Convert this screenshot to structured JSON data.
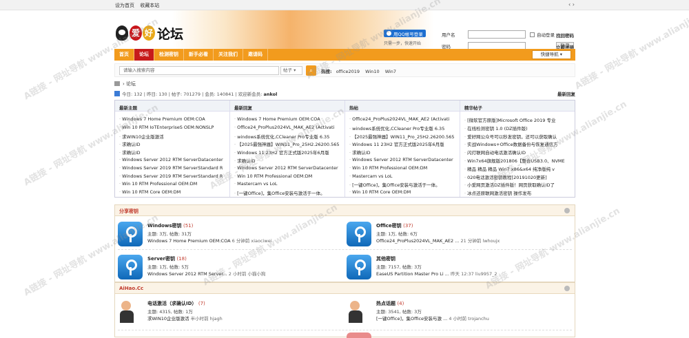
{
  "topbar": {
    "set_home": "设为首页",
    "bookmark": "收藏本站",
    "arrows": "‹ ›"
  },
  "logo": {
    "char1": "爱",
    "char2": "好",
    "title": "论坛"
  },
  "qq_login": {
    "button": "用QQ帐号登录",
    "hint": "只需一步，快速开始"
  },
  "login": {
    "username_label": "用户名",
    "password_label": "密码",
    "remember": "自动登录",
    "forgot": "找回密码",
    "submit": "登录",
    "register": "立即注册"
  },
  "nav": {
    "items": [
      "首页",
      "论坛",
      "检测密钥",
      "新手必看",
      "关注我们",
      "邀请码"
    ],
    "active_index": 1,
    "quick": "快捷导航 ▾"
  },
  "search": {
    "placeholder": "请输入搜索内容",
    "type": "帖子 ▾",
    "hot_label": "热搜:",
    "hot": [
      "office2019",
      "Win10",
      "Win7"
    ]
  },
  "breadcrumb": {
    "current": "论坛"
  },
  "stats": {
    "text": "今日: 132  |  昨日: 130  |  帖子: 701279  |  会员: 140841  |  欢迎新会员: ",
    "newest": "ankol",
    "latest": "最新回复"
  },
  "panels": [
    {
      "title": "最新主题",
      "items": [
        "Windows 7 Home Premium OEM:COA",
        "Win 10 RTM IoTEnterpriseS OEM:NONSLP",
        "求WIN10企业版激活",
        "求确认ID",
        "求确认ID",
        "Windows Server 2012 RTM ServerDatacenter",
        "Windows Server 2019 RTM ServerStandard R",
        "Windows Server 2019 RTM ServerStandard R",
        "Win 10 RTM Professional OEM:DM",
        "Win 10 RTM Core OEM:DM"
      ]
    },
    {
      "title": "最新回复",
      "items": [
        "Windows 7 Home Premium OEM:COA",
        "Office24_ProPlus2024VL_MAK_AE2 (Activati",
        "windows系统优化,CCleaner Pro专业版 6.35",
        "【2025最强神器】WIN11_Pro_25H2.26200.565",
        "Windows 11 23H2 官方正式版2025年6月版",
        "求确认ID",
        "Windows Server 2012 RTM ServerDatacenter",
        "Win 10 RTM Professional OEM:DM",
        "Mastercam vs LoL",
        "[一键Office]，集Office安装与激活于一体。"
      ]
    },
    {
      "title": "热帖",
      "items": [
        "Office24_ProPlus2024VL_MAK_AE2 (Activati",
        "windows系统优化,CCleaner Pro专业版 6.35",
        "【2025最强神器】WIN11_Pro_25H2.26200.565",
        "Windows 11 23H2 官方正式版2025年6月版",
        "求确认ID",
        "Windows Server 2012 RTM ServerDatacenter",
        "Win 10 RTM Professional OEM:DM",
        "Mastercam vs LoL",
        "[一键Office]，集Office安装与激活于一体。",
        "Win 10 RTM Core OEM:DM"
      ]
    },
    {
      "title": "精华帖子",
      "items": [
        "[微软官方原版]Microsoft Office 2019 专业",
        "在线检测密钥 1.0 (DZ插件版)",
        "爱好网公众号可以秒发密钥，还可以获取确认",
        "实战Windows+Office数据备份与恢复通信方",
        "闪灯联网自动电话激活确认ID",
        "Win7x64旗舰版201806【整合USB3.0、NVME",
        "精品 精品 精品 Win7 x86&x64 纯净版纯 v",
        "020电话激活密钥教程[20191020更新]",
        "小爱网页激活DZ插件版！网页获取确认ID了",
        "冰点还原联网激活密钥 操作发布"
      ]
    }
  ],
  "section1": {
    "title": "分享密钥",
    "forums": [
      {
        "name": "Windows密钥",
        "count": "(51)",
        "meta": "主题: 3万, 帖数: 31万",
        "last": "Windows 7 Home Premium OEM:COA",
        "time": "6 分钟前 xiaociwei"
      },
      {
        "name": "Office密钥",
        "count": "(37)",
        "meta": "主题: 1万, 帖数: 6万",
        "last": "Office24_ProPlus2024VL_MAK_AE2 ...",
        "time": "21 分钟前 lwhoujx"
      },
      {
        "name": "Server密钥",
        "count": "(18)",
        "meta": "主题: 1万, 帖数: 5万",
        "last": "Windows Server 2012 RTM Server...",
        "time": "2 小时前 小猫小狗"
      },
      {
        "name": "其他密钥",
        "count": "",
        "meta": "主题: 7157, 帖数: 3万",
        "last": "EaseUS Partition Master Pro Li ...",
        "time": "昨天 12:37 liu9957_2"
      }
    ]
  },
  "section2": {
    "title": "AiHao.Cc",
    "forums": [
      {
        "name": "电话激活（求确认ID）",
        "count": "(7)",
        "meta": "主题: 4315, 帖数: 1万",
        "last": "求WIN10企业版激活",
        "time": "半小时前 hjagh"
      },
      {
        "name": "热点话题",
        "count": "(4)",
        "meta": "主题: 3541, 帖数: 3万",
        "last": "[一键Office]，集Office安装与激 ...",
        "time": "4 小时前 trojanchu"
      }
    ]
  },
  "watermark": "A链接 - 网址导航  www.alianjie.cn"
}
